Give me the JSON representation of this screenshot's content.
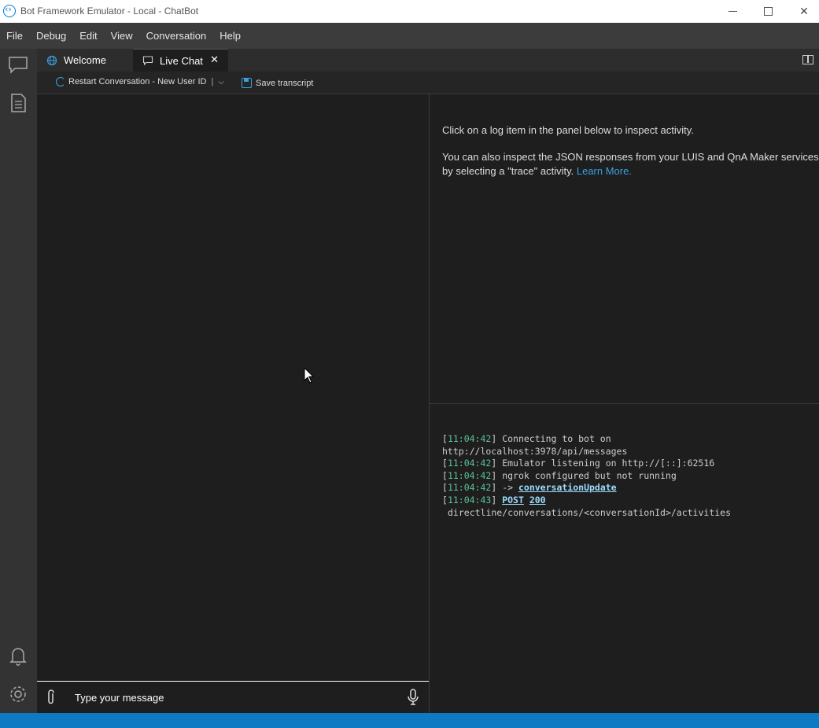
{
  "window": {
    "title": "Bot Framework Emulator - Local - ChatBot"
  },
  "menu": [
    "File",
    "Debug",
    "Edit",
    "View",
    "Conversation",
    "Help"
  ],
  "tabs": [
    {
      "label": "Welcome",
      "icon": "globe-icon",
      "active": false
    },
    {
      "label": "Live Chat",
      "icon": "chat-icon",
      "active": true
    }
  ],
  "toolbar": {
    "restart_label": "Restart Conversation - New User ID",
    "restart_sep": "|",
    "save_label": "Save transcript"
  },
  "chat": {
    "placeholder": "Type your message"
  },
  "inspector": {
    "line1": "Click on a log item in the panel below to inspect activity.",
    "line2": "You can also inspect the JSON responses from your LUIS and QnA Maker services by selecting a \"trace\" activity.",
    "learn_more": "Learn More."
  },
  "log": [
    {
      "ts": "11:04:42",
      "text": "Connecting to bot on"
    },
    {
      "cont": "http://localhost:3978/api/messages"
    },
    {
      "ts": "11:04:42",
      "text": "Emulator listening on http://[::]:62516"
    },
    {
      "ts": "11:04:42",
      "text": "ngrok configured but not running"
    },
    {
      "ts": "11:04:42",
      "arrow": "->",
      "link": "conversationUpdate"
    },
    {
      "ts": "11:04:43",
      "method": "POST",
      "status": "200"
    },
    {
      "cont": "directline/conversations/<conversationId>/activities"
    }
  ],
  "colors": {
    "accent": "#0e7ac4",
    "timestamp": "#5cc295",
    "link": "#3aa0e0"
  }
}
